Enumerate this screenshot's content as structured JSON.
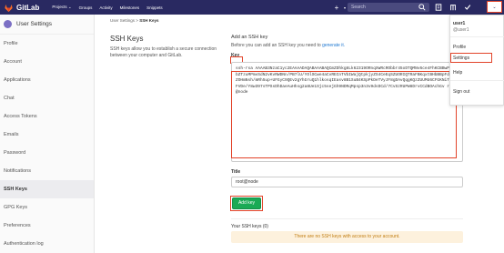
{
  "topbar": {
    "app_name": "GitLab",
    "nav": [
      "Projects ⌄",
      "Groups",
      "Activity",
      "Milestones",
      "Snippets"
    ],
    "search_placeholder": "Search",
    "plus_icon": "plus-icon",
    "avatar_label": "⌄"
  },
  "sidebar": {
    "title": "User Settings",
    "items": [
      "Profile",
      "Account",
      "Applications",
      "Chat",
      "Access Tokens",
      "Emails",
      "Password",
      "Notifications",
      "SSH Keys",
      "GPG Keys",
      "Preferences",
      "Authentication log"
    ],
    "active_index": 8
  },
  "breadcrumb": {
    "parent": "User Settings",
    "sep": ">",
    "current": "SSH Keys"
  },
  "left": {
    "heading": "SSH Keys",
    "description": "SSH keys allow you to establish a secure connection between your computer and GitLab."
  },
  "form": {
    "add_title": "Add an SSH key",
    "add_desc_prefix": "Before you can add an SSH key you need to",
    "add_desc_link": "generate it.",
    "key_label": "Key",
    "key_value": "ssh-rsa AAAAB3NzaC1yc2EAAAADAQABAAABAQCmZDhkg8Lk62319ORnqXWRcRObbr45oDTQMNv6ce4FhKCBBwPovobZTzuMPmvSdN2vKvRWDNn/PB7lU/YOlSCwe4aCvRECnTVbIWajQtpkjyZS4CeEqSZUORIQTRaFBKqxtBHbBBpFdKEhZOHmNsh/mRh5up+UFGyC9QEv2gYhGruQ1hlkosqIEasv8B1SuB4KSpPkDeTVyJF8gDAvQqgKQzZUUMU6CFGKNiT7f7FVDe/Y8w397sTPSsDhDaeAuHhsg2a8Ue1Sjc5sejGh9NDRqMpsp3n3v9dsDCd/7CvSzRUPW8DrvCCdBOAchGv root@node",
    "title_label": "Title",
    "title_value": "root@node",
    "add_button": "Add key",
    "your_keys": "Your SSH keys (0)",
    "no_keys": "There are no SSH keys with access to your account."
  },
  "dropdown": {
    "user": "user1",
    "handle": "@user1",
    "items": [
      "Profile",
      "Settings",
      "Help",
      "Sign out"
    ]
  },
  "colors": {
    "topbar": "#292961",
    "highlight": "#e24329",
    "add_button": "#1aaa55",
    "warning_bg": "#fdf1dd"
  }
}
